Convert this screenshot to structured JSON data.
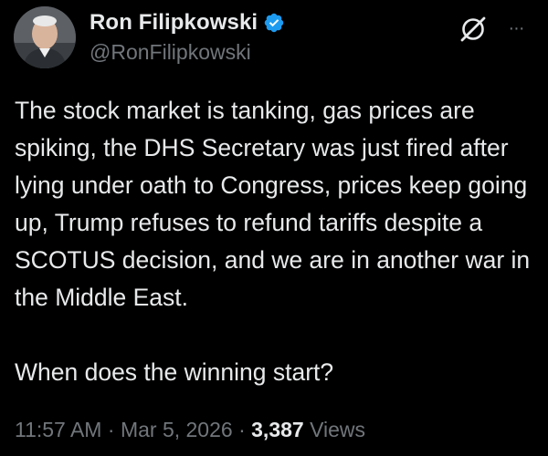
{
  "author": {
    "display_name": "Ron Filipkowski",
    "handle": "@RonFilipkowski",
    "verified": true,
    "verified_color": "#1d9bf0"
  },
  "header_icons": {
    "grok": "grok-icon",
    "more": "more-options-icon",
    "more_glyph": "···"
  },
  "tweet": {
    "paragraphs": [
      "The stock market is tanking, gas prices are spiking, the DHS Secretary was just fired after lying under oath to Congress, prices keep going up, Trump refuses to refund tariffs despite a SCOTUS decision, and we are in another war in the Middle East.",
      "When does the winning start?"
    ]
  },
  "meta": {
    "time": "11:57 AM",
    "separator": "·",
    "date": "Mar 5, 2026",
    "views_count": "3,387",
    "views_label": "Views"
  },
  "colors": {
    "background": "#000000",
    "primary_text": "#e7e9ea",
    "secondary_text": "#71767b"
  }
}
